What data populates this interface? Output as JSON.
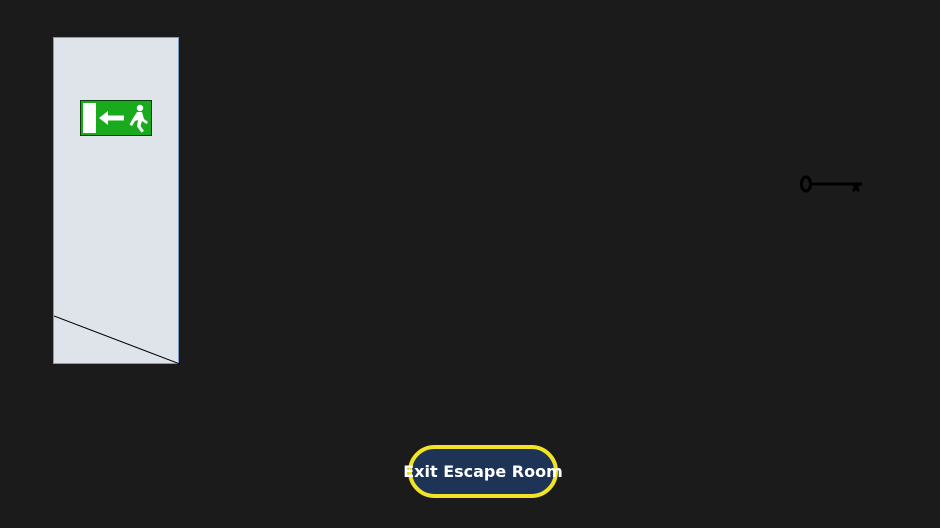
{
  "scene": {
    "background_color": "#1b1b1b"
  },
  "door": {
    "color": "#dfe3ea",
    "border_color": "#7a9cc6",
    "sign": {
      "icon": "emergency-exit-running-man-icon",
      "color": "#1aaa1e"
    }
  },
  "key": {
    "icon": "key-icon"
  },
  "exit_button": {
    "label": "Exit Escape Room",
    "fill_color": "#1e3457",
    "border_color": "#f2e424"
  }
}
